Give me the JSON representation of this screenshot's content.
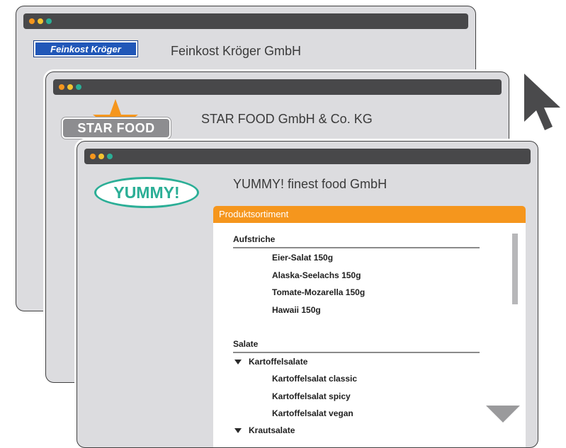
{
  "colors": {
    "dot_orange": "#f5961d",
    "dot_yellow": "#f4c430",
    "dot_teal": "#2bae96",
    "titlebar": "#48484a",
    "accent_orange": "#f5961d",
    "yummy_teal": "#2bae96",
    "feinkost_blue": "#2157b8",
    "window_bg": "#dcdcdf"
  },
  "window1": {
    "logo_text": "Feinkost Kröger",
    "company_name": "Feinkost Kröger GmbH"
  },
  "window2": {
    "logo_text": "STAR FOOD",
    "company_name": "STAR FOOD GmbH & Co. KG"
  },
  "window3": {
    "logo_text": "YUMMY!",
    "company_name": "YUMMY! finest food GmbH",
    "panel_title": "Produktsortiment",
    "sections": [
      {
        "title": "Aufstriche",
        "items": [
          "Eier-Salat 150g",
          "Alaska-Seelachs 150g",
          "Tomate-Mozarella 150g",
          "Hawaii 150g"
        ]
      },
      {
        "title": "Salate",
        "groups": [
          {
            "label": "Kartoffelsalate",
            "items": [
              "Kartoffelsalat classic",
              "Kartoffelsalat spicy",
              "Kartoffelsalat vegan"
            ]
          },
          {
            "label": "Krautsalate",
            "items": []
          }
        ]
      }
    ]
  },
  "icons": {
    "cursor": "mouse-pointer-icon",
    "expand": "triangle-down-icon",
    "scroll_down": "scroll-down-arrow-icon"
  }
}
